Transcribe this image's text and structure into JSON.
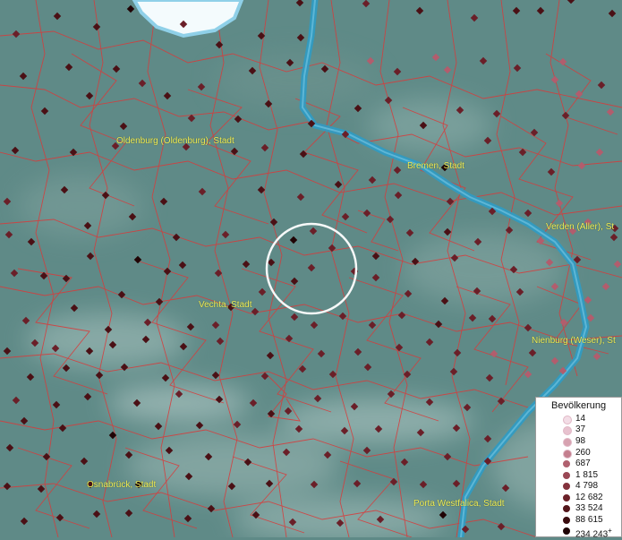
{
  "map": {
    "cities": [
      {
        "name": "Oldenburg (Oldenburg), Stadt"
      },
      {
        "name": "Bremen, Stadt"
      },
      {
        "name": "Verden (Aller), St"
      },
      {
        "name": "Vechta, Stadt"
      },
      {
        "name": "Nienburg (Weser), St"
      },
      {
        "name": "Osnabrück, Stadt"
      },
      {
        "name": "Porta Westfalica, Stadt"
      }
    ],
    "colors": {
      "terrain": "#5f8a87",
      "boundaries": "#d93a3a",
      "river": "#2f9bc4",
      "lake": "#ffffff",
      "label": "#f0ef5a",
      "selection_circle": "#ffffff"
    }
  },
  "legend": {
    "title": "Bevölkerung",
    "entries": [
      {
        "label": "14",
        "color": "#f3dde6"
      },
      {
        "label": "37",
        "color": "#e8c2cf"
      },
      {
        "label": "98",
        "color": "#d7a2b0"
      },
      {
        "label": "260",
        "color": "#c47f8e"
      },
      {
        "label": "687",
        "color": "#b0616f"
      },
      {
        "label": "1 815",
        "color": "#9a4855"
      },
      {
        "label": "4 798",
        "color": "#84323d"
      },
      {
        "label": "12 682",
        "color": "#6c2129"
      },
      {
        "label": "33 524",
        "color": "#53151a"
      },
      {
        "label": "88 615",
        "color": "#3a0c0f"
      },
      {
        "label": "234 243",
        "color": "#200405"
      }
    ],
    "overflow_mark": "+"
  }
}
